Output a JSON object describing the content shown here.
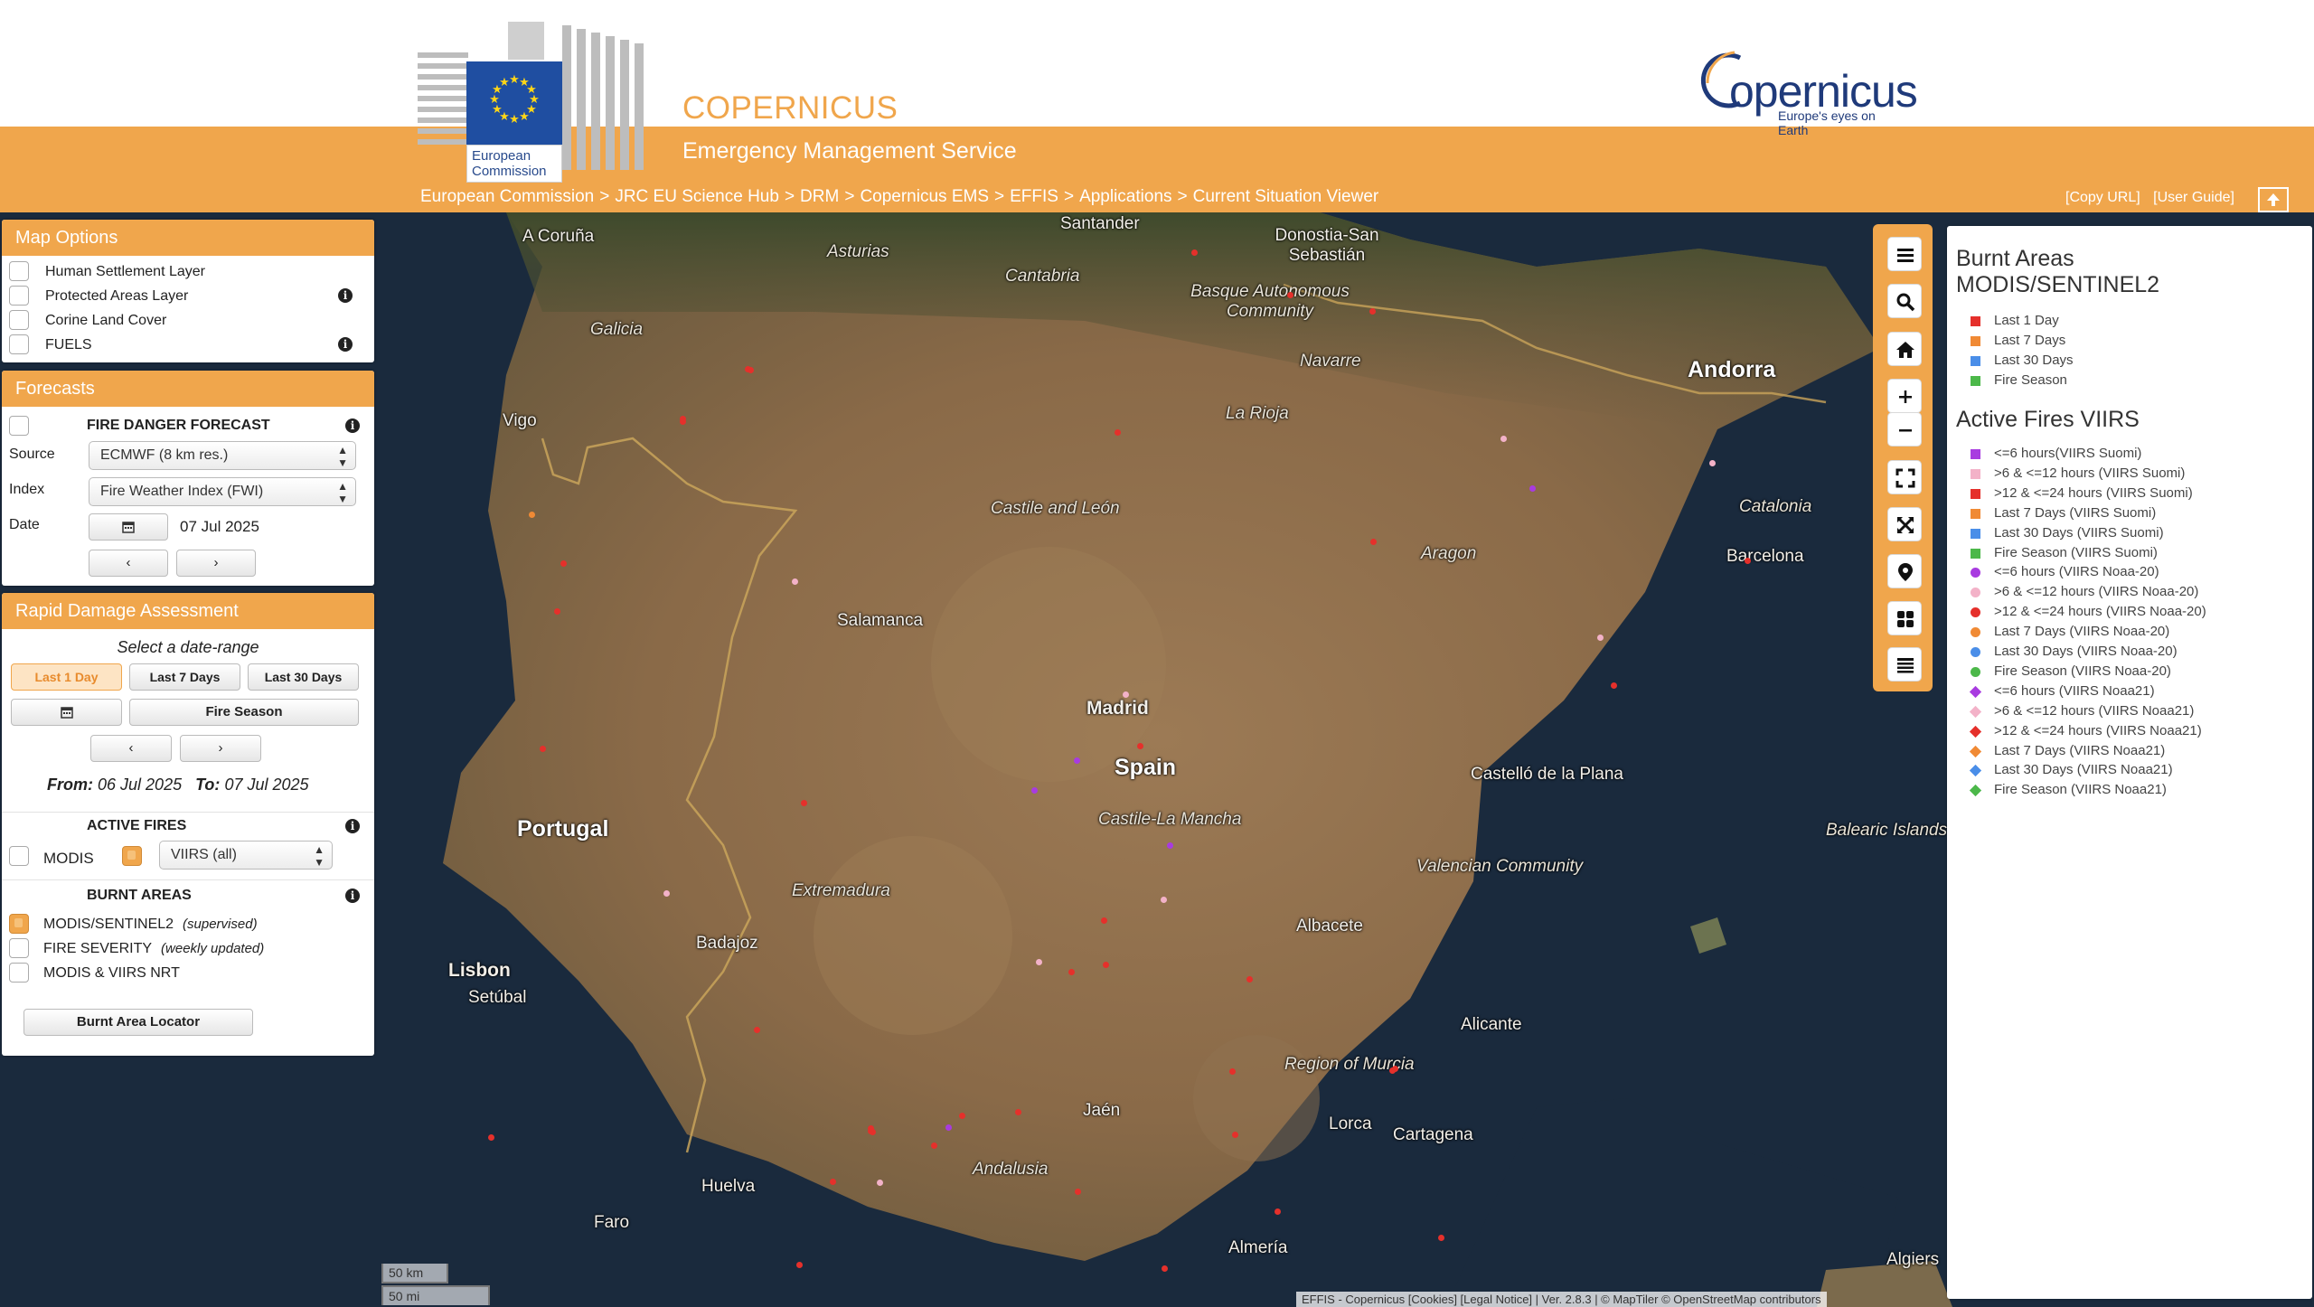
{
  "header": {
    "ec_caption": "European Commission",
    "service_name": "COPERNICUS",
    "service_subtitle": "Emergency Management Service",
    "copernicus_word": "opernicus",
    "copernicus_tagline": "Europe's eyes on Earth",
    "breadcrumb": [
      "European Commission",
      "JRC EU Science Hub",
      "DRM",
      "Copernicus EMS",
      "EFFIS",
      "Applications",
      "Current Situation Viewer"
    ],
    "breadcrumb_separator": ">",
    "copy_url": "[Copy URL]",
    "user_guide": "[User Guide]"
  },
  "map_options": {
    "title": "Map Options",
    "layers": [
      {
        "label": "Human Settlement Layer",
        "checked": false,
        "info": false
      },
      {
        "label": "Protected Areas Layer",
        "checked": false,
        "info": true
      },
      {
        "label": "Corine Land Cover",
        "checked": false,
        "info": false
      },
      {
        "label": "FUELS",
        "checked": false,
        "info": true
      }
    ]
  },
  "forecasts": {
    "title": "Forecasts",
    "heading": "FIRE DANGER FORECAST",
    "source_label": "Source",
    "source_value": "ECMWF (8 km res.)",
    "index_label": "Index",
    "index_value": "Fire Weather Index (FWI)",
    "date_label": "Date",
    "date_value": "07 Jul 2025",
    "prev": "‹",
    "next": "›"
  },
  "rda": {
    "title": "Rapid Damage Assessment",
    "select_range": "Select a date-range",
    "range_buttons": [
      "Last 1 Day",
      "Last 7 Days",
      "Last 30 Days"
    ],
    "active_range": "Last 1 Day",
    "fire_season": "Fire Season",
    "prev": "‹",
    "next": "›",
    "from_label": "From:",
    "from_value": "06 Jul 2025",
    "to_label": "To:",
    "to_value": "07 Jul 2025",
    "active_fires_heading": "ACTIVE FIRES",
    "modis_label": "MODIS",
    "viirs_value": "VIIRS (all)",
    "burnt_areas_heading": "BURNT AREAS",
    "burnt_layers": [
      {
        "label": "MODIS/SENTINEL2",
        "note": "(supervised)",
        "checked": true
      },
      {
        "label": "FIRE SEVERITY",
        "note": "(weekly updated)",
        "checked": false
      },
      {
        "label": "MODIS & VIIRS NRT",
        "note": "",
        "checked": false
      }
    ],
    "locator_button": "Burnt Area Locator"
  },
  "toolbar": {
    "buttons": [
      "menu-icon",
      "search-icon",
      "home-icon",
      "zoom-in-icon",
      "zoom-out-icon",
      "fullscreen-icon",
      "extent-icon",
      "location-pin-icon",
      "basemap-grid-icon",
      "list-icon"
    ]
  },
  "legend": {
    "burnt_title": "Burnt Areas MODIS/SENTINEL2",
    "burnt_items": [
      {
        "label": "Last 1 Day",
        "color": "#e5302b",
        "shape": "square"
      },
      {
        "label": "Last 7 Days",
        "color": "#f08a35",
        "shape": "square"
      },
      {
        "label": "Last 30 Days",
        "color": "#4a8ee8",
        "shape": "square"
      },
      {
        "label": "Fire Season",
        "color": "#4cb84a",
        "shape": "square"
      }
    ],
    "active_title": "Active Fires VIIRS",
    "active_items": [
      {
        "label": "<=6 hours(VIIRS Suomi)",
        "color": "#a83be0",
        "shape": "square"
      },
      {
        "label": ">6 & <=12 hours (VIIRS Suomi)",
        "color": "#f3b2c8",
        "shape": "square"
      },
      {
        "label": ">12 & <=24 hours (VIIRS Suomi)",
        "color": "#e5302b",
        "shape": "square"
      },
      {
        "label": "Last 7 Days (VIIRS Suomi)",
        "color": "#f08a35",
        "shape": "square"
      },
      {
        "label": "Last 30 Days (VIIRS Suomi)",
        "color": "#4a8ee8",
        "shape": "square"
      },
      {
        "label": "Fire Season (VIIRS Suomi)",
        "color": "#4cb84a",
        "shape": "square"
      },
      {
        "label": "<=6 hours (VIIRS Noaa-20)",
        "color": "#a83be0",
        "shape": "circle"
      },
      {
        "label": ">6 & <=12 hours (VIIRS Noaa-20)",
        "color": "#f3b2c8",
        "shape": "circle"
      },
      {
        "label": ">12 & <=24 hours (VIIRS Noaa-20)",
        "color": "#e5302b",
        "shape": "circle"
      },
      {
        "label": "Last 7 Days (VIIRS Noaa-20)",
        "color": "#f08a35",
        "shape": "circle"
      },
      {
        "label": "Last 30 Days (VIIRS Noaa-20)",
        "color": "#4a8ee8",
        "shape": "circle"
      },
      {
        "label": "Fire Season (VIIRS Noaa-20)",
        "color": "#4cb84a",
        "shape": "circle"
      },
      {
        "label": "<=6 hours (VIIRS Noaa21)",
        "color": "#a83be0",
        "shape": "diamond"
      },
      {
        "label": ">6 & <=12 hours (VIIRS Noaa21)",
        "color": "#f3b2c8",
        "shape": "diamond"
      },
      {
        "label": ">12 & <=24 hours (VIIRS Noaa21)",
        "color": "#e5302b",
        "shape": "diamond"
      },
      {
        "label": "Last 7 Days (VIIRS Noaa21)",
        "color": "#f08a35",
        "shape": "diamond"
      },
      {
        "label": "Last 30 Days (VIIRS Noaa21)",
        "color": "#4a8ee8",
        "shape": "diamond"
      },
      {
        "label": "Fire Season (VIIRS Noaa21)",
        "color": "#4cb84a",
        "shape": "diamond"
      }
    ]
  },
  "map": {
    "countries": [
      "Portugal",
      "Spain",
      "Andorra"
    ],
    "regions": [
      "Asturias",
      "Cantabria",
      "Basque Autonomous Community",
      "Galicia",
      "Navarre",
      "La Rioja",
      "Castile and León",
      "Aragon",
      "Catalonia",
      "Extremadura",
      "Castile-La Mancha",
      "Valencian Community",
      "Region of Murcia",
      "Andalusia",
      "Balearic Islands"
    ],
    "cities": [
      "A Coruña",
      "Santander",
      "Donostia-San Sebastián",
      "Vigo",
      "Salamanca",
      "Madrid",
      "Barcelona",
      "Castelló de la Plana",
      "Badajoz",
      "Albacete",
      "Lisbon",
      "Setúbal",
      "Alicante",
      "Jaén",
      "Lorca",
      "Cartagena",
      "Huelva",
      "Faro",
      "Almería",
      "Algiers"
    ],
    "scale_km": "50 km",
    "scale_mi": "50 mi",
    "attribution": "EFFIS - Copernicus [Cookies] [Legal Notice] | Ver. 2.8.3 | © MapTiler © OpenStreetMap contributors"
  },
  "colors": {
    "accent": "#f0a64c",
    "eu_blue": "#1f4ea1",
    "copernicus_blue": "#1f3a7a"
  }
}
